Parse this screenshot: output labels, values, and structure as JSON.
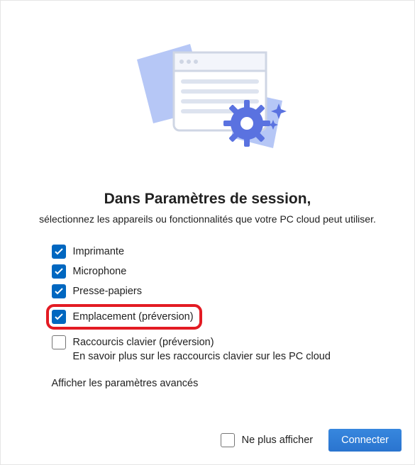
{
  "heading": "Dans Paramètres de session,",
  "subtitle": "sélectionnez les appareils ou fonctionnalités que votre PC cloud peut utiliser.",
  "options": {
    "printer": {
      "label": "Imprimante",
      "checked": true
    },
    "microphone": {
      "label": "Microphone",
      "checked": true
    },
    "clipboard": {
      "label": "Presse-papiers",
      "checked": true
    },
    "location": {
      "label": "Emplacement (préversion)",
      "checked": true,
      "highlighted": true
    },
    "shortcuts": {
      "label": "Raccourcis clavier (préversion)",
      "checked": false,
      "sub": "En savoir plus sur les raccourcis clavier sur les PC cloud"
    }
  },
  "advanced_label": "Afficher les paramètres avancés",
  "footer": {
    "dont_show_label": "Ne plus afficher",
    "dont_show_checked": false,
    "connect_label": "Connecter"
  },
  "icons": {
    "illustration": "session-settings-illustration"
  },
  "colors": {
    "brand_blue": "#0067c0",
    "highlight_red": "#e31b23"
  }
}
